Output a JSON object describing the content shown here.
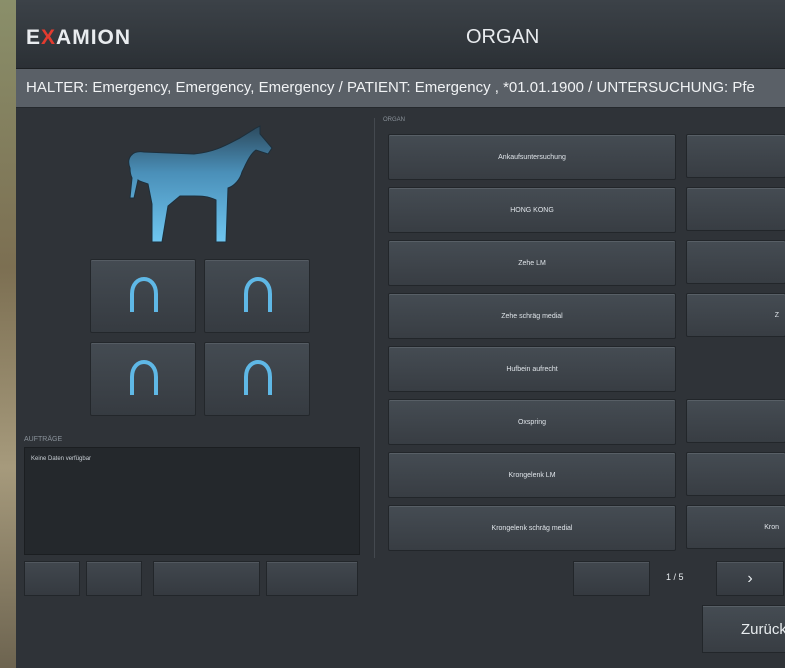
{
  "header": {
    "logo_prefix": "E",
    "logo_x": "X",
    "logo_rest": "AMION",
    "title": "ORGAN"
  },
  "infobar": {
    "text": "HALTER: Emergency, Emergency, Emergency / PATIENT: Emergency , *01.01.1900 / UNTERSUCHUNG: Pfe"
  },
  "left": {
    "horse_icon": "horse-icon",
    "hoof_icon": "horseshoe-icon",
    "notes_label": "AUFTRÄGE",
    "notes_text": "Keine Daten verfügbar"
  },
  "organ": {
    "section_label": "ORGAN",
    "left_column": [
      "Ankaufsuntersuchung",
      "HONG KONG",
      "Zehe LM",
      "Zehe schräg medial",
      "Hufbein aufrecht",
      "Oxspring",
      "Krongelenk LM",
      "Krongelenk schräg medial"
    ],
    "right_column": [
      "",
      "",
      "",
      "Z",
      "",
      "",
      "",
      "Kron"
    ]
  },
  "pager": {
    "page": "1 / 5",
    "next": "›"
  },
  "footer": {
    "back_label": "Zurück"
  },
  "colors": {
    "accent": "#e33b2f",
    "horse_blue": "#5fb8e6",
    "background": "#2f3338"
  }
}
